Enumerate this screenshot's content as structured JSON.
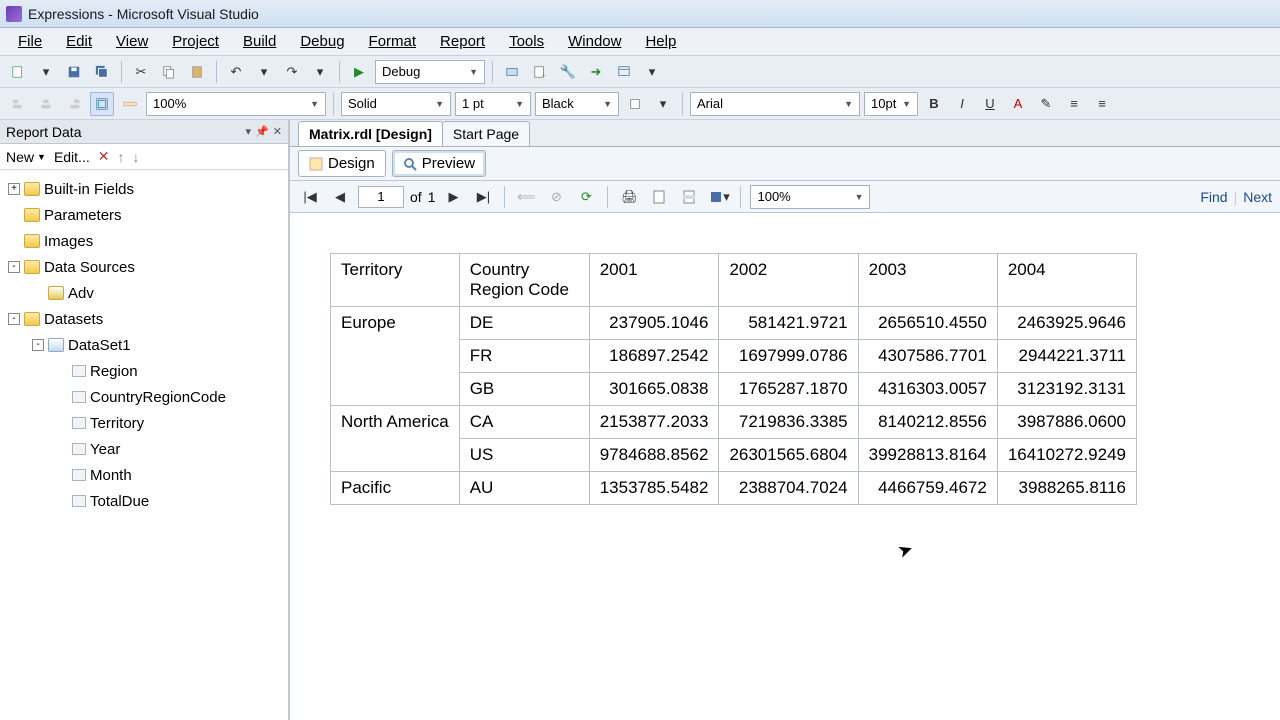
{
  "window": {
    "title": "Expressions - Microsoft Visual Studio"
  },
  "menus": [
    "File",
    "Edit",
    "View",
    "Project",
    "Build",
    "Debug",
    "Format",
    "Report",
    "Tools",
    "Window",
    "Help"
  ],
  "toolbar1": {
    "config": "Debug"
  },
  "toolbar2": {
    "zoom": "100%",
    "border_style": "Solid",
    "border_width": "1 pt",
    "border_color": "Black",
    "font_family": "Arial",
    "font_size": "10pt"
  },
  "report_data": {
    "title": "Report Data",
    "new_label": "New",
    "edit_label": "Edit...",
    "tree": [
      {
        "level": 1,
        "toggle": "+",
        "icon": "folder",
        "label": "Built-in Fields"
      },
      {
        "level": 1,
        "toggle": "",
        "icon": "folder",
        "label": "Parameters"
      },
      {
        "level": 1,
        "toggle": "",
        "icon": "folder",
        "label": "Images"
      },
      {
        "level": 1,
        "toggle": "-",
        "icon": "folder",
        "label": "Data Sources"
      },
      {
        "level": 2,
        "toggle": "",
        "icon": "ds",
        "label": "Adv"
      },
      {
        "level": 1,
        "toggle": "-",
        "icon": "folder",
        "label": "Datasets"
      },
      {
        "level": 2,
        "toggle": "-",
        "icon": "table",
        "label": "DataSet1"
      },
      {
        "level": 3,
        "toggle": "",
        "icon": "field",
        "label": "Region"
      },
      {
        "level": 3,
        "toggle": "",
        "icon": "field",
        "label": "CountryRegionCode"
      },
      {
        "level": 3,
        "toggle": "",
        "icon": "field",
        "label": "Territory"
      },
      {
        "level": 3,
        "toggle": "",
        "icon": "field",
        "label": "Year"
      },
      {
        "level": 3,
        "toggle": "",
        "icon": "field",
        "label": "Month"
      },
      {
        "level": 3,
        "toggle": "",
        "icon": "field",
        "label": "TotalDue"
      }
    ]
  },
  "doc_tabs": {
    "active": "Matrix.rdl [Design]",
    "other": "Start Page"
  },
  "view_tabs": {
    "design": "Design",
    "preview": "Preview"
  },
  "preview_bar": {
    "page": "1",
    "of": "of",
    "total": "1",
    "zoom": "100%",
    "find": "Find",
    "next": "Next"
  },
  "matrix": {
    "header1": "Territory",
    "header2": "Country Region Code",
    "years": [
      "2001",
      "2002",
      "2003",
      "2004"
    ],
    "rows": [
      {
        "territory": "Europe",
        "code": "DE",
        "vals": [
          "237905.1046",
          "581421.9721",
          "2656510.4550",
          "2463925.9646"
        ]
      },
      {
        "territory": "",
        "code": "FR",
        "vals": [
          "186897.2542",
          "1697999.0786",
          "4307586.7701",
          "2944221.3711"
        ]
      },
      {
        "territory": "",
        "code": "GB",
        "vals": [
          "301665.0838",
          "1765287.1870",
          "4316303.0057",
          "3123192.3131"
        ]
      },
      {
        "territory": "North America",
        "code": "CA",
        "vals": [
          "2153877.2033",
          "7219836.3385",
          "8140212.8556",
          "3987886.0600"
        ]
      },
      {
        "territory": "",
        "code": "US",
        "vals": [
          "9784688.8562",
          "26301565.6804",
          "39928813.8164",
          "16410272.9249"
        ]
      },
      {
        "territory": "Pacific",
        "code": "AU",
        "vals": [
          "1353785.5482",
          "2388704.7024",
          "4466759.4672",
          "3988265.8116"
        ]
      }
    ]
  }
}
